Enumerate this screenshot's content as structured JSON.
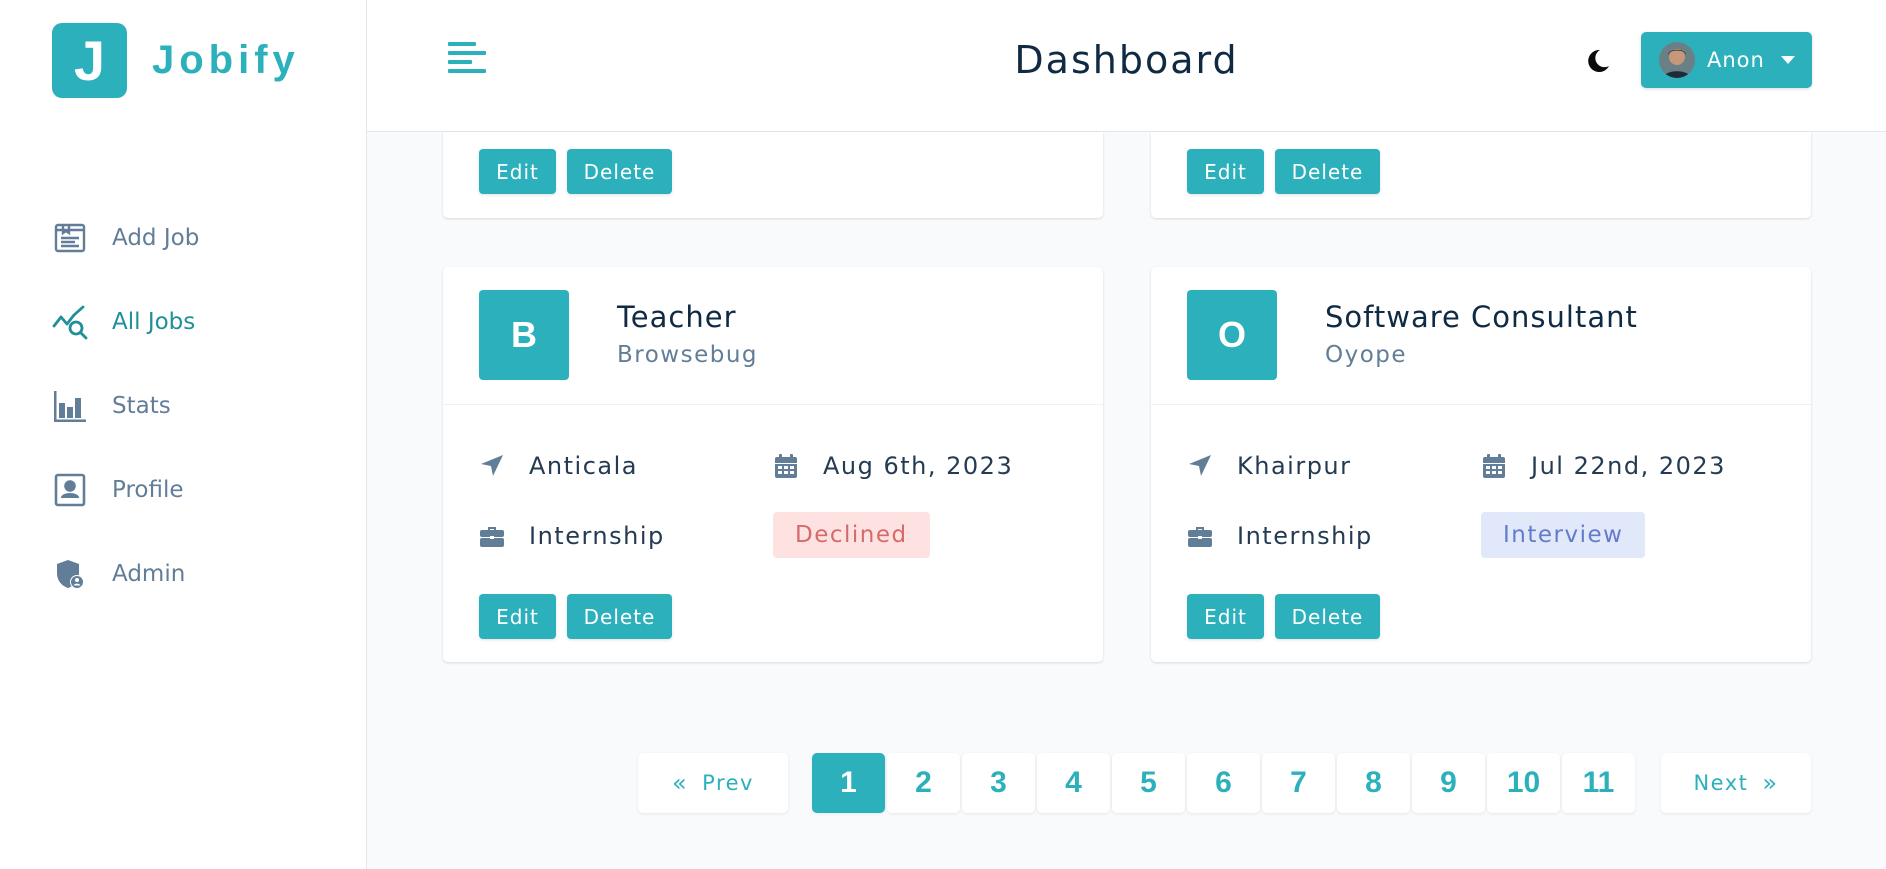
{
  "brand": {
    "logo_letter": "J",
    "name": "Jobify"
  },
  "header": {
    "title": "Dashboard",
    "user_name": "Anon"
  },
  "sidebar": {
    "items": [
      {
        "label": "Add Job",
        "icon": "add-job-icon",
        "active": false
      },
      {
        "label": "All Jobs",
        "icon": "all-jobs-icon",
        "active": true
      },
      {
        "label": "Stats",
        "icon": "stats-icon",
        "active": false
      },
      {
        "label": "Profile",
        "icon": "profile-icon",
        "active": false
      },
      {
        "label": "Admin",
        "icon": "admin-icon",
        "active": false
      }
    ]
  },
  "actions": {
    "edit_label": "Edit",
    "delete_label": "Delete"
  },
  "jobs": [
    {
      "letter": "B",
      "position": "Teacher",
      "company": "Browsebug",
      "location": "Anticala",
      "date": "Aug 6th, 2023",
      "type": "Internship",
      "status": "Declined"
    },
    {
      "letter": "O",
      "position": "Software Consultant",
      "company": "Oyope",
      "location": "Khairpur",
      "date": "Jul 22nd, 2023",
      "type": "Internship",
      "status": "Interview"
    }
  ],
  "pagination": {
    "prev_label": "Prev",
    "next_label": "Next",
    "pages": [
      "1",
      "2",
      "3",
      "4",
      "5",
      "6",
      "7",
      "8",
      "9",
      "10",
      "11"
    ],
    "current": "1"
  },
  "colors": {
    "primary": "#2cb1bc",
    "declined_bg": "#fee2e2",
    "declined_text": "#d66a6a",
    "interview_bg": "#e0e8f9",
    "interview_text": "#647acb"
  }
}
